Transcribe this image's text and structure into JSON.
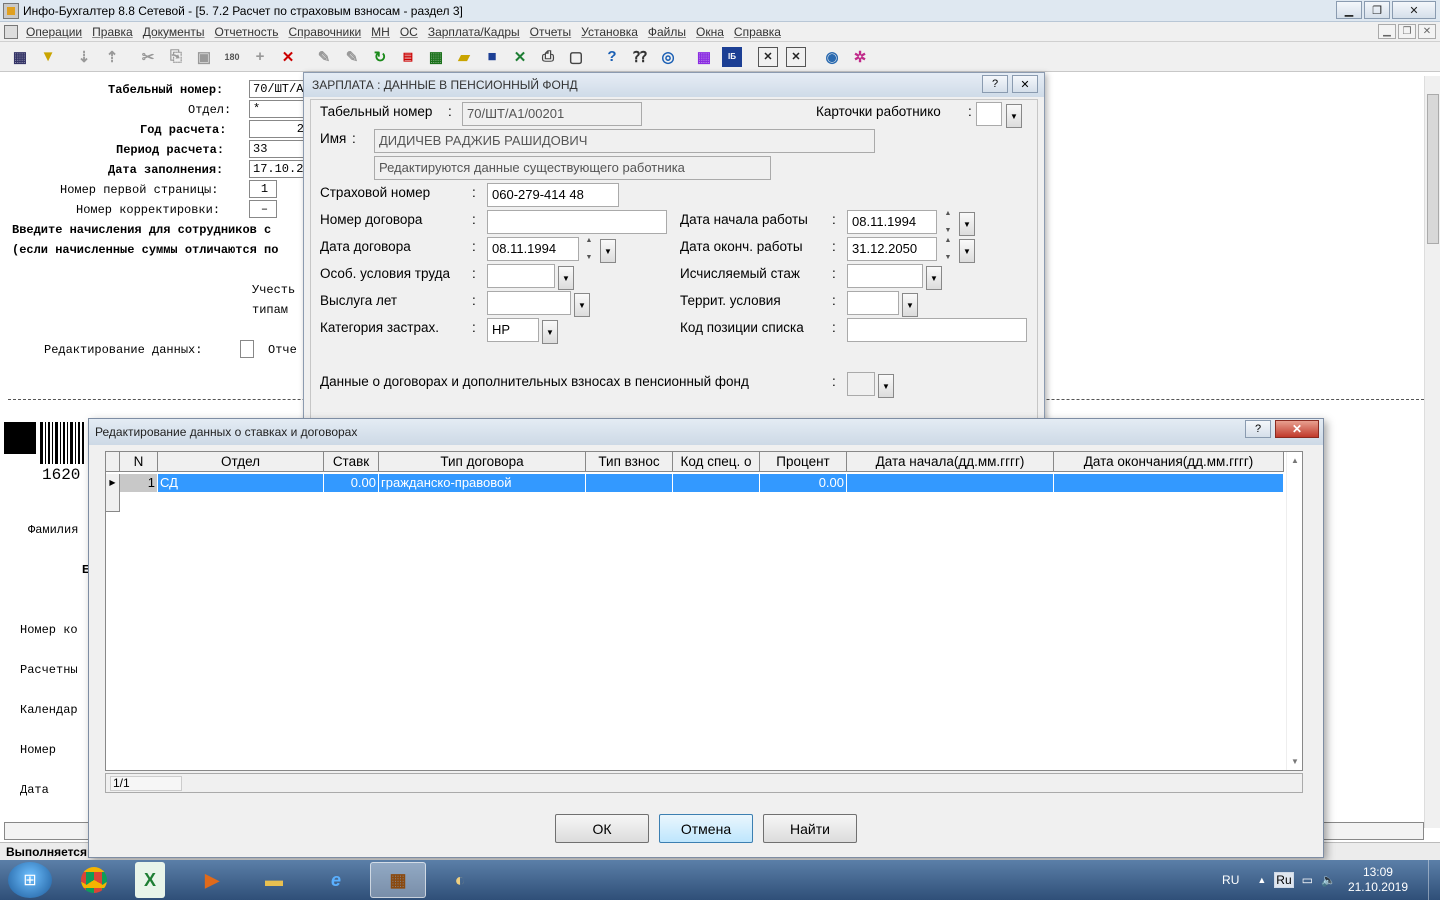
{
  "window": {
    "title": "Инфо-Бухгалтер 8.8 Сетевой - [5.  7.2 Расчет по страховым взносам - раздел 3]"
  },
  "menu": [
    "Операции",
    "Правка",
    "Документы",
    "Отчетность",
    "Справочники",
    "МН",
    "ОС",
    "Зарплата/Кадры",
    "Отчеты",
    "Установка",
    "Файлы",
    "Окна",
    "Справка"
  ],
  "background": {
    "tab_label": "Табельный номер:",
    "tab_value": "70/ШТ/А",
    "dept_label": "Отдел:",
    "dept_value": "*",
    "year_label": "Год расчета:",
    "year_value": "2",
    "period_label": "Период расчета:",
    "period_value": "33",
    "fill_date_label": "Дата заполнения:",
    "fill_date_value": "17.10.2",
    "first_page_label": "Номер первой страницы:",
    "first_page_value": "1",
    "correction_label": "Номер корректировки:",
    "correction_value": "–",
    "instruction1": "Введите начисления для сотрудников с",
    "instruction2": "(если начисленные суммы отличаются по",
    "consider": "Учесть",
    "types": "типам",
    "edit_label": "Редактирование данных:",
    "report": "Отче",
    "barcode_number": "1620",
    "surname": "Фамилия",
    "doc_number": "Номер ко",
    "calc": "Расчетны",
    "calendar": "Календар",
    "number": "Номер",
    "date": "Дата",
    "initial": "Е",
    "status": "Выполняется"
  },
  "pf_dialog": {
    "title": "ЗАРПЛАТА : ДАННЫЕ В ПЕНСИОННЫЙ ФОНД",
    "tab_label": "Табельный номер",
    "tab_value": "70/ШТ/А1/00201",
    "cards_label": "Карточки работнико",
    "name_label": "Имя",
    "name_value": "ДИДИЧЕВ РАДЖИБ РАШИДОВИЧ",
    "editing_note": "Редактируются данные существующего работника",
    "insurance_label": "Страховой номер",
    "insurance_value": "060-279-414 48",
    "contract_no_label": "Номер договора",
    "contract_no_value": "",
    "contract_date_label": "Дата договора",
    "contract_date_value": "08.11.1994",
    "conditions_label": "Особ. условия труда",
    "conditions_value": "",
    "seniority_label": "Выслуга лет",
    "seniority_value": "",
    "category_label": "Категория застрах.",
    "category_value": "НР",
    "start_label": "Дата начала работы",
    "start_value": "08.11.1994",
    "end_label": "Дата оконч. работы",
    "end_value": "31.12.2050",
    "calc_exp_label": "Исчисляемый стаж",
    "calc_exp_value": "",
    "territory_label": "Террит. условия",
    "territory_value": "",
    "position_code_label": "Код позиции списка",
    "position_code_value": "",
    "contracts_label": "Данные о договорах и дополнительных взносах в пенсионный фонд",
    "colon": ":",
    "ghost_buttons": [
      "ОК",
      "Отмена",
      "Справка"
    ]
  },
  "rates_dialog": {
    "title": "Редактирование данных о ставках и договорах",
    "columns": [
      "N",
      "Отдел",
      "Ставк",
      "Тип договора",
      "Тип взнос",
      "Код спец. о",
      "Процент",
      "Дата начала(дд.мм.гггг)",
      "Дата окончания(дд.мм.гггг)"
    ],
    "rows": [
      {
        "n": "1",
        "dept": "СД",
        "rate": "0.00",
        "contract_type": "гражданско-правовой",
        "contrib_type": "",
        "spec_code": "",
        "percent": "0.00",
        "start": "",
        "end": ""
      }
    ],
    "record_counter": "1/1",
    "ok_label": "ОК",
    "cancel_label": "Отмена",
    "find_label": "Найти"
  },
  "taskbar": {
    "lang": "RU",
    "lang2": "Ru",
    "time": "13:09",
    "date": "21.10.2019"
  },
  "colors": {
    "selection": "#3399ff",
    "taskbar": "#2f4f78"
  }
}
